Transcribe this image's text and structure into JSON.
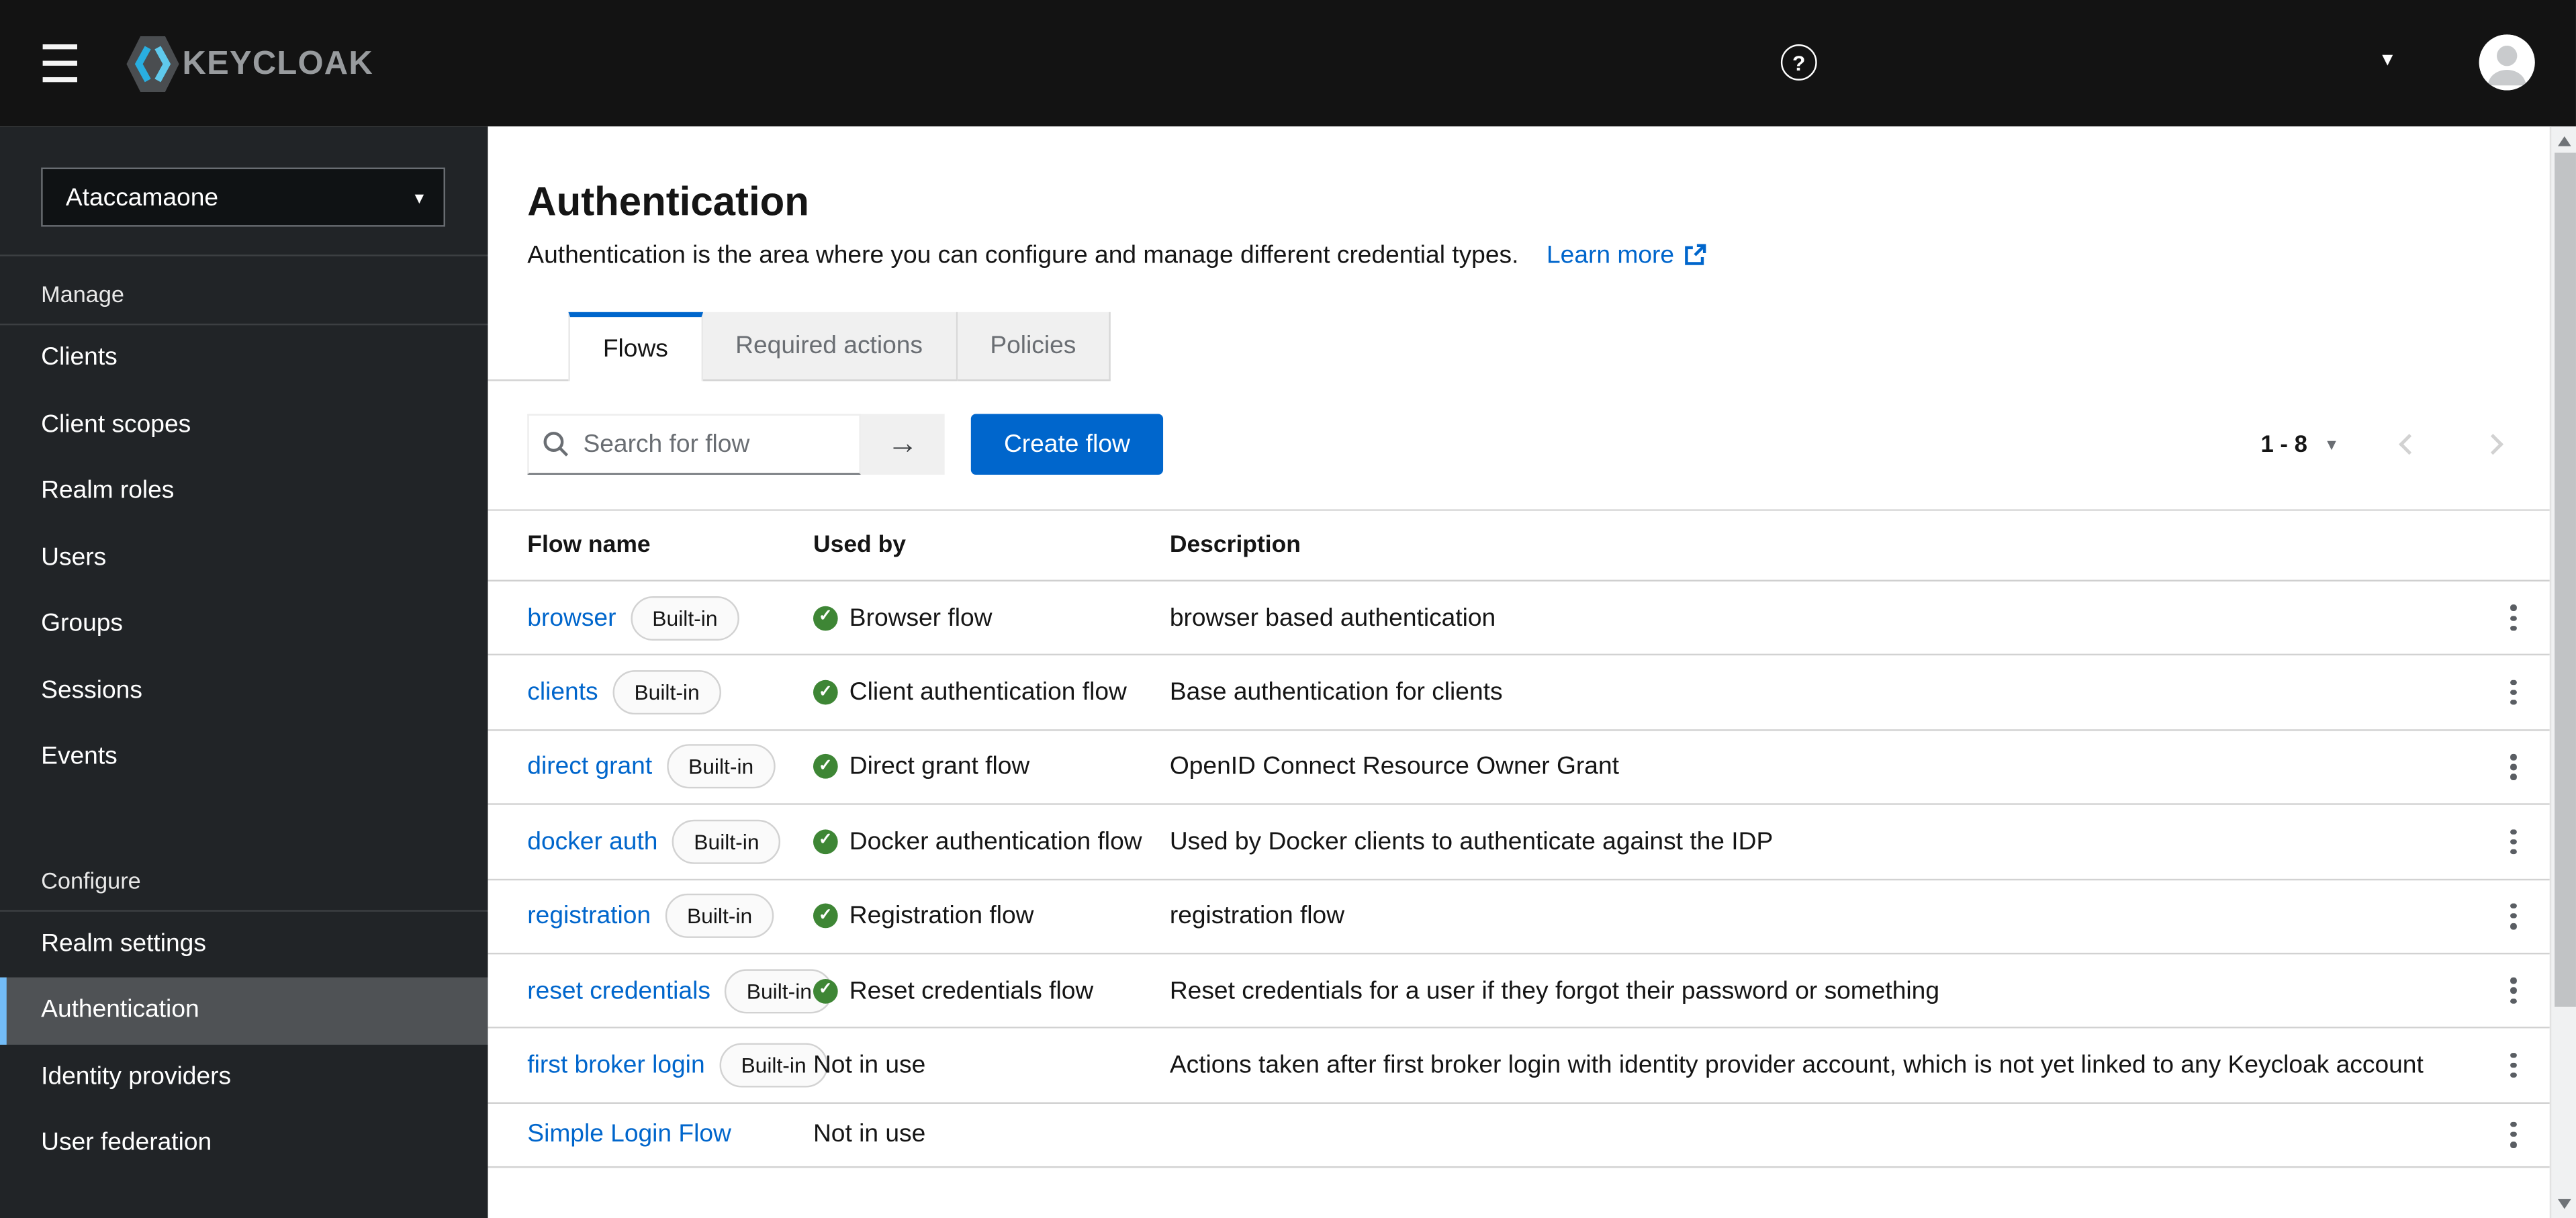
{
  "colors": {
    "accent": "#0066cc",
    "link": "#0066cc",
    "success_green": "#3e8635",
    "masthead_bg": "#131313",
    "sidebar_bg": "#212427",
    "selected_nav_bg": "#4f5255",
    "selected_nav_border": "#73bcf7",
    "badge_border": "#d2d2d2"
  },
  "icons": {
    "menu": "hamburger-bars",
    "help": "?",
    "caret_down": "▾",
    "search": "magnifier",
    "search_submit": "→",
    "external_link": "box-arrow",
    "check": "✓",
    "chevron_left": "‹",
    "chevron_right": "›",
    "kebab": "⋮",
    "scrollbar_up": "▲",
    "scrollbar_down": "▼",
    "avatar": "person-silhouette"
  },
  "header": {
    "brand": "KEYCLOAK"
  },
  "sidebar": {
    "realm": "Ataccamaone",
    "sections": [
      {
        "label": "Manage",
        "items": [
          {
            "label": "Clients"
          },
          {
            "label": "Client scopes"
          },
          {
            "label": "Realm roles"
          },
          {
            "label": "Users"
          },
          {
            "label": "Groups"
          },
          {
            "label": "Sessions"
          },
          {
            "label": "Events"
          }
        ]
      },
      {
        "label": "Configure",
        "items": [
          {
            "label": "Realm settings"
          },
          {
            "label": "Authentication",
            "selected": true
          },
          {
            "label": "Identity providers"
          },
          {
            "label": "User federation"
          }
        ]
      }
    ]
  },
  "main": {
    "title": "Authentication",
    "subtitle": "Authentication is the area where you can configure and manage different credential types.",
    "learn_more_label": "Learn more",
    "tabs": [
      {
        "label": "Flows",
        "active": true
      },
      {
        "label": "Required actions",
        "active": false
      },
      {
        "label": "Policies",
        "active": false
      }
    ],
    "toolbar": {
      "search_placeholder": "Search for flow",
      "create_button_label": "Create flow"
    },
    "pagination": {
      "range": "1 - 8"
    },
    "table": {
      "columns": [
        "Flow name",
        "Used by",
        "Description"
      ],
      "rows": [
        {
          "name": "browser",
          "badge": "Built-in",
          "used_by": "Browser flow",
          "in_use": true,
          "description": "browser based authentication"
        },
        {
          "name": "clients",
          "badge": "Built-in",
          "used_by": "Client authentication flow",
          "in_use": true,
          "description": "Base authentication for clients"
        },
        {
          "name": "direct grant",
          "badge": "Built-in",
          "used_by": "Direct grant flow",
          "in_use": true,
          "description": "OpenID Connect Resource Owner Grant"
        },
        {
          "name": "docker auth",
          "badge": "Built-in",
          "used_by": "Docker authentication flow",
          "in_use": true,
          "description": "Used by Docker clients to authenticate against the IDP"
        },
        {
          "name": "registration",
          "badge": "Built-in",
          "used_by": "Registration flow",
          "in_use": true,
          "description": "registration flow"
        },
        {
          "name": "reset credentials",
          "badge": "Built-in",
          "used_by": "Reset credentials flow",
          "in_use": true,
          "description": "Reset credentials for a user if they forgot their password or something"
        },
        {
          "name": "first broker login",
          "badge": "Built-in",
          "used_by": "Not in use",
          "in_use": false,
          "description": "Actions taken after first broker login with identity provider account, which is not yet linked to any Keycloak account"
        },
        {
          "name": "Simple Login Flow",
          "badge": null,
          "used_by": "Not in use",
          "in_use": false,
          "description": ""
        }
      ]
    }
  }
}
